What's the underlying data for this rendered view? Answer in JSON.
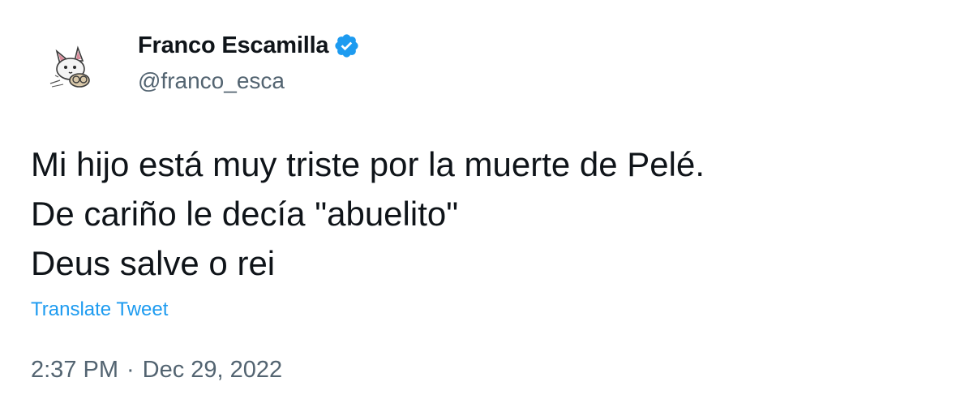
{
  "author": {
    "display_name": "Franco Escamilla",
    "handle": "@franco_esca",
    "verified_icon": "verified-badge-icon",
    "avatar_icon": "cartoon-cat-avatar"
  },
  "tweet": {
    "lines": [
      "Mi hijo está muy triste por la muerte de Pelé.",
      "De cariño le decía \"abuelito\"",
      "Deus salve o rei"
    ],
    "translate_label": "Translate Tweet",
    "time": "2:37 PM",
    "separator": "·",
    "date": "Dec 29, 2022"
  },
  "colors": {
    "primary_text": "#0f1419",
    "secondary_text": "#536471",
    "accent_blue": "#1d9bf0"
  }
}
